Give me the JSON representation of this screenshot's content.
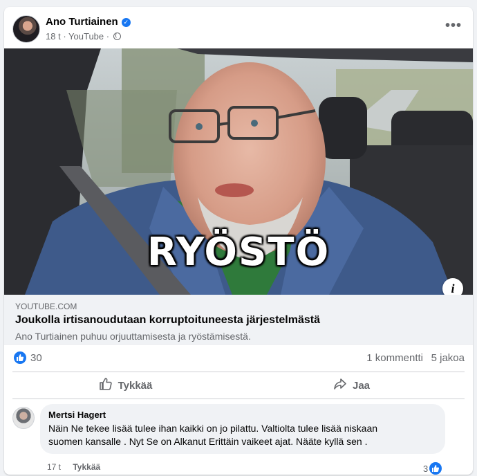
{
  "post": {
    "author": "Ano Turtiainen",
    "time": "18 t",
    "source": "YouTube",
    "separator": "·",
    "more_icon": "more-horizontal-icon",
    "verified_icon": "verified-badge-icon",
    "audience_icon": "globe-icon"
  },
  "video": {
    "overlay_text": "RYÖSTÖ",
    "info_icon": "info-icon"
  },
  "link": {
    "domain": "YOUTUBE.COM",
    "title": "Joukolla irtisanoudutaan korruptoituneesta järjestelmästä",
    "description": "Ano Turtiainen puhuu orjuuttamisesta ja ryöstämisestä."
  },
  "stats": {
    "reactions": "30",
    "comments": "1 kommentti",
    "shares": "5 jakoa"
  },
  "actions": {
    "like_label": "Tykkää",
    "share_label": "Jaa"
  },
  "comment": {
    "name": "Mertsi Hagert",
    "line1": "Näin Ne tekee lisää tulee ihan kaikki on jo pilattu. Valtiolta tulee lisää niskaan",
    "line2": "suomen kansalle . Nyt Se on Alkanut Erittäin vaikeet ajat. Nääte kyllä sen .",
    "time": "17 t",
    "like_label": "Tykkää",
    "reaction_count": "3"
  },
  "colors": {
    "accent": "#1877f2",
    "secondary_text": "#65676b",
    "background": "#f0f2f5"
  }
}
